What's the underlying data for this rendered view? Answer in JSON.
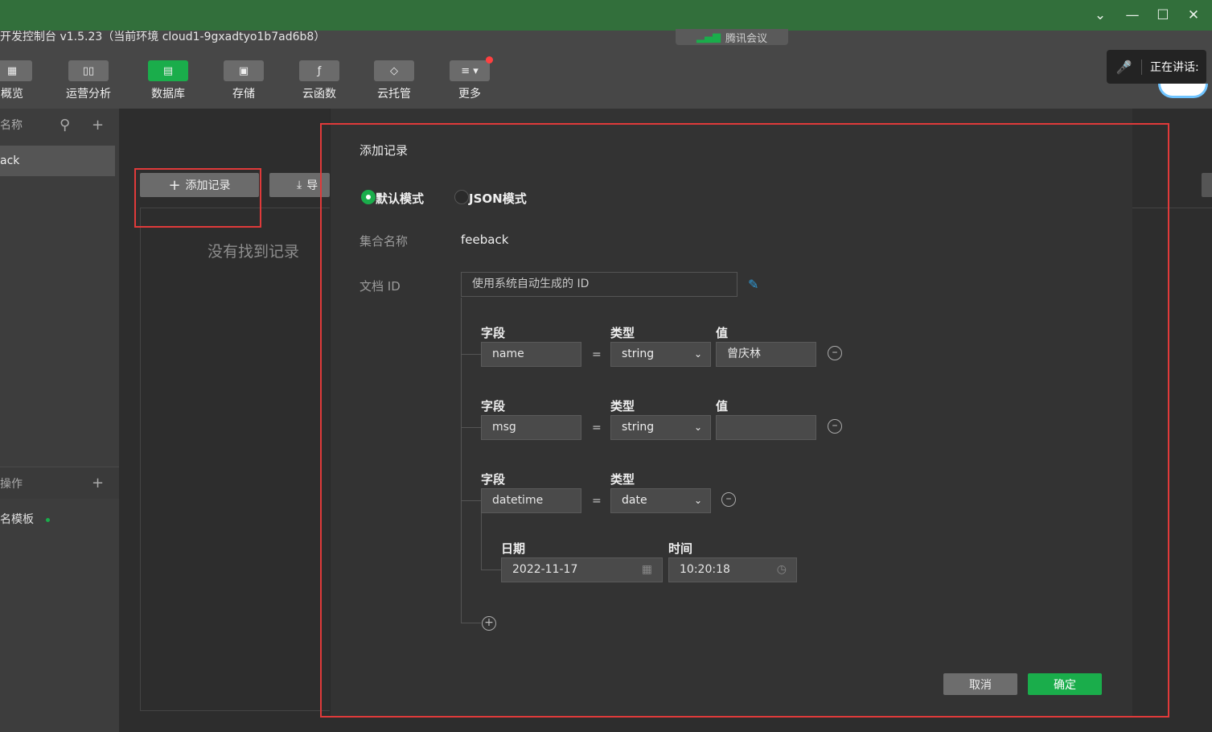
{
  "app": {
    "title_strip": "开发控制台 v1.5.23（当前环境 cloud1-9gxadtyo1b7ad6b8）",
    "meeting_badge": "腾讯会议"
  },
  "talking": {
    "label": "正在讲话:"
  },
  "toolbar": {
    "items": [
      {
        "label": "概览",
        "icon": "grid-icon",
        "active": false
      },
      {
        "label": "运营分析",
        "icon": "bar-chart-icon",
        "active": false
      },
      {
        "label": "数据库",
        "icon": "database-icon",
        "active": true
      },
      {
        "label": "存储",
        "icon": "save-icon",
        "active": false
      },
      {
        "label": "云函数",
        "icon": "function-icon",
        "active": false
      },
      {
        "label": "云托管",
        "icon": "cube-icon",
        "active": false
      },
      {
        "label": "更多",
        "icon": "layers-icon",
        "active": false
      }
    ]
  },
  "sidebar": {
    "collections_header": "名称",
    "collection_item": "ack",
    "ops_header": "操作",
    "template_item": "名模板"
  },
  "main": {
    "add_record_button": "添加记录",
    "export_button": "导",
    "empty_text": "没有找到记录"
  },
  "modal": {
    "title": "添加记录",
    "mode_default": "默认模式",
    "mode_json": "JSON模式",
    "collection_label": "集合名称",
    "collection_value": "feeback",
    "docid_label": "文档 ID",
    "docid_value": "使用系统自动生成的 ID",
    "col_field": "字段",
    "col_type": "类型",
    "col_value": "值",
    "eq_sign": "=",
    "rows": [
      {
        "field": "name",
        "type": "string",
        "value": "曾庆林"
      },
      {
        "field": "msg",
        "type": "string",
        "value": ""
      },
      {
        "field": "datetime",
        "type": "date"
      }
    ],
    "date_label": "日期",
    "time_label": "时间",
    "date_value": "2022-11-17",
    "time_value": "10:20:18",
    "cancel_label": "取消",
    "ok_label": "确定"
  },
  "colors": {
    "accent": "#1aad4b",
    "title_bar": "#326f3b",
    "annotation": "#e03a3a"
  }
}
